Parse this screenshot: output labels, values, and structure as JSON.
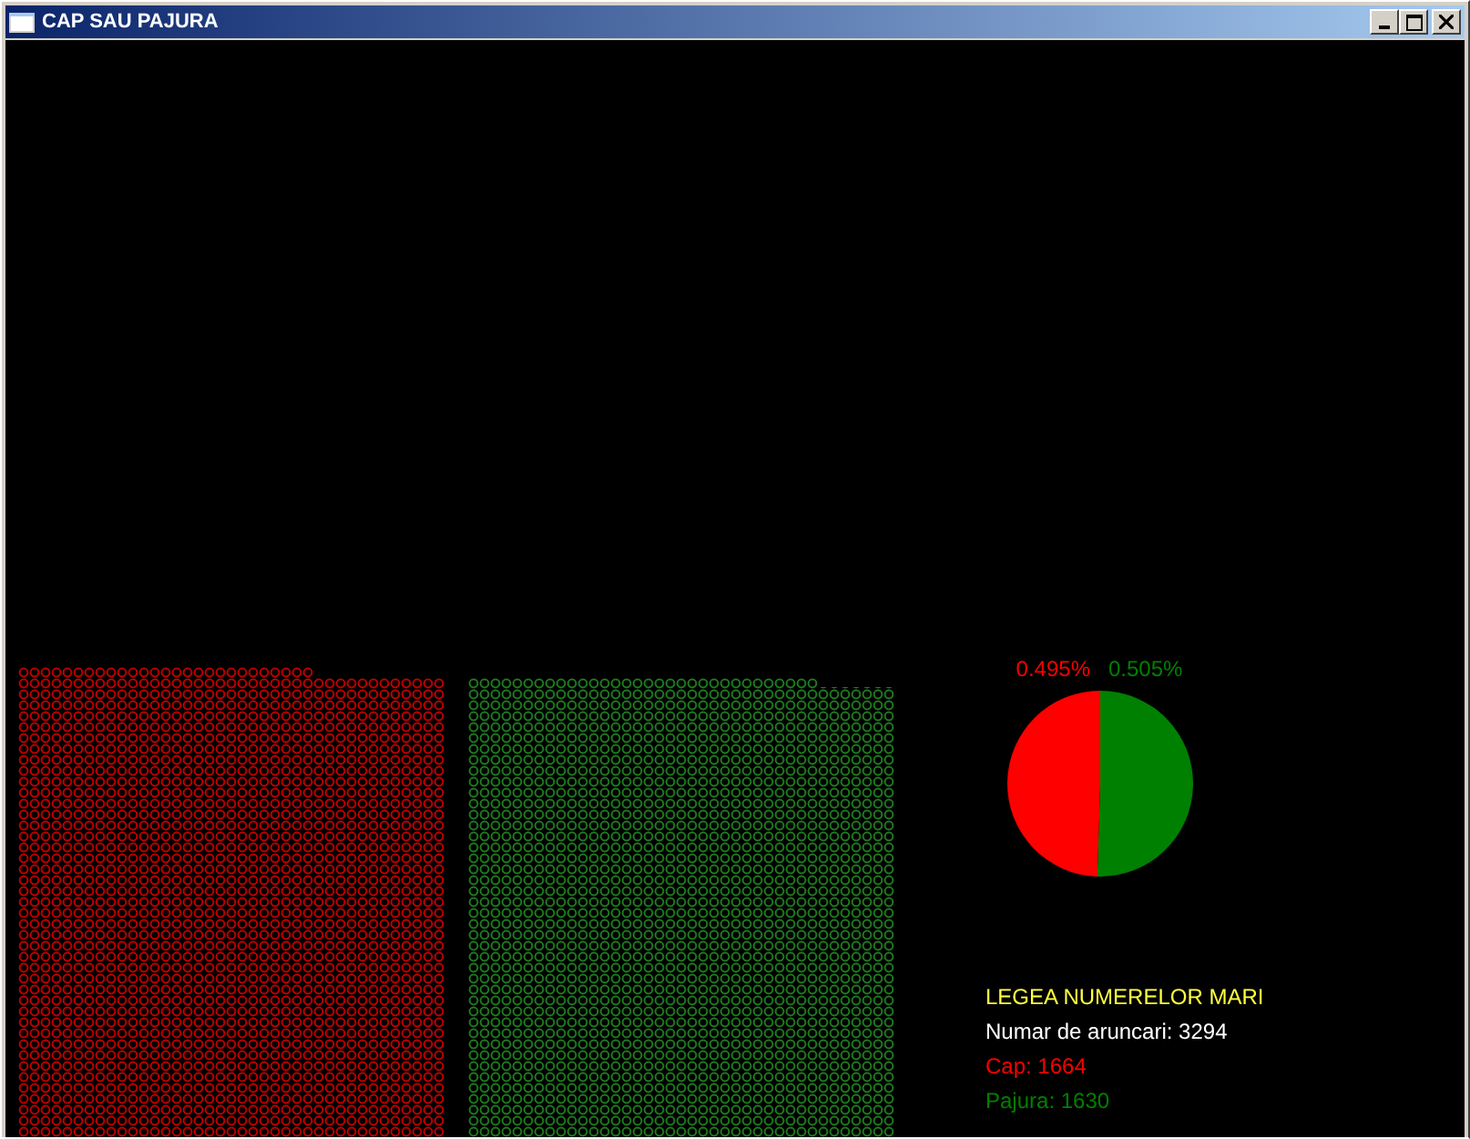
{
  "window": {
    "title": "CAP SAU PAJURA"
  },
  "pie": {
    "labels": [
      {
        "text": "0.495%",
        "color": "#ff0000"
      },
      {
        "text": "0.505%",
        "color": "#008000"
      }
    ],
    "chart_data": {
      "type": "pie",
      "values": [
        0.495,
        0.505
      ]
    }
  },
  "legend": {
    "title": "LEGEA NUMERELOR MARI",
    "lines": [
      {
        "text": "Numar de aruncari: 3294",
        "color": "#ffffff"
      },
      {
        "text": "Cap: 1664",
        "color": "#ff0000"
      },
      {
        "text": "Pajura: 1630",
        "color": "#008000"
      }
    ]
  }
}
